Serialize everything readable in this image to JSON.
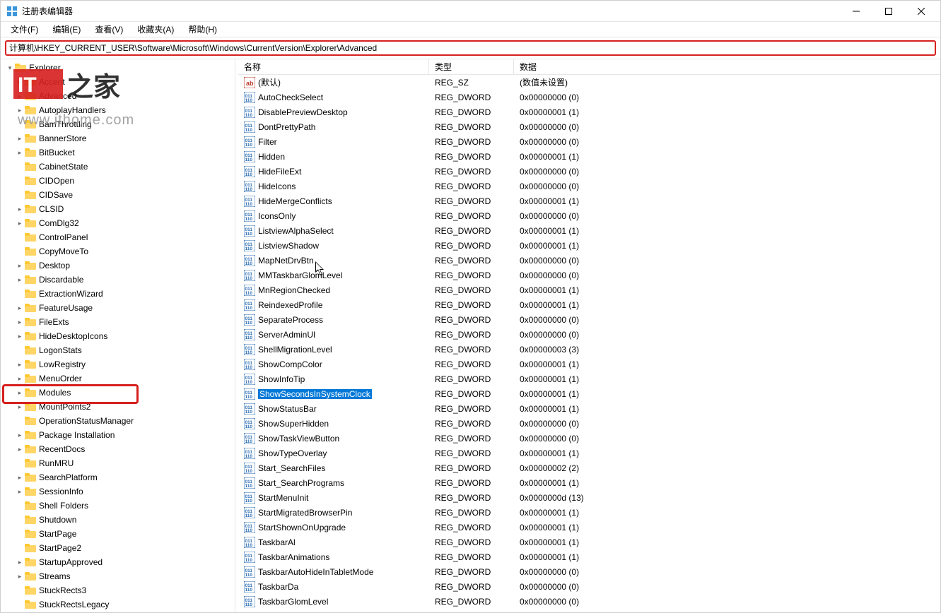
{
  "window": {
    "title": "注册表编辑器"
  },
  "menubar": {
    "file": "文件(F)",
    "edit": "编辑(E)",
    "view": "查看(V)",
    "favorites": "收藏夹(A)",
    "help": "帮助(H)"
  },
  "address": "计算机\\HKEY_CURRENT_USER\\Software\\Microsoft\\Windows\\CurrentVersion\\Explorer\\Advanced",
  "columns": {
    "name": "名称",
    "type": "类型",
    "data": "数据"
  },
  "tree": {
    "items": [
      {
        "label": "Explorer",
        "depth": 0,
        "expanded": true
      },
      {
        "label": "Accent",
        "depth": 1,
        "expandable": true
      },
      {
        "label": "Advanced",
        "depth": 1,
        "expandable": true,
        "truncated": true
      },
      {
        "label": "AutoplayHandlers",
        "depth": 1,
        "expandable": true
      },
      {
        "label": "BamThrottling",
        "depth": 1
      },
      {
        "label": "BannerStore",
        "depth": 1,
        "expandable": true
      },
      {
        "label": "BitBucket",
        "depth": 1,
        "expandable": true
      },
      {
        "label": "CabinetState",
        "depth": 1
      },
      {
        "label": "CIDOpen",
        "depth": 1
      },
      {
        "label": "CIDSave",
        "depth": 1
      },
      {
        "label": "CLSID",
        "depth": 1,
        "expandable": true
      },
      {
        "label": "ComDlg32",
        "depth": 1,
        "expandable": true
      },
      {
        "label": "ControlPanel",
        "depth": 1
      },
      {
        "label": "CopyMoveTo",
        "depth": 1
      },
      {
        "label": "Desktop",
        "depth": 1,
        "expandable": true
      },
      {
        "label": "Discardable",
        "depth": 1,
        "expandable": true
      },
      {
        "label": "ExtractionWizard",
        "depth": 1
      },
      {
        "label": "FeatureUsage",
        "depth": 1,
        "expandable": true
      },
      {
        "label": "FileExts",
        "depth": 1,
        "expandable": true
      },
      {
        "label": "HideDesktopIcons",
        "depth": 1,
        "expandable": true
      },
      {
        "label": "LogonStats",
        "depth": 1
      },
      {
        "label": "LowRegistry",
        "depth": 1,
        "expandable": true
      },
      {
        "label": "MenuOrder",
        "depth": 1,
        "expandable": true
      },
      {
        "label": "Modules",
        "depth": 1,
        "expandable": true
      },
      {
        "label": "MountPoints2",
        "depth": 1,
        "expandable": true
      },
      {
        "label": "OperationStatusManager",
        "depth": 1
      },
      {
        "label": "Package Installation",
        "depth": 1,
        "expandable": true
      },
      {
        "label": "RecentDocs",
        "depth": 1,
        "expandable": true
      },
      {
        "label": "RunMRU",
        "depth": 1
      },
      {
        "label": "SearchPlatform",
        "depth": 1,
        "expandable": true
      },
      {
        "label": "SessionInfo",
        "depth": 1,
        "expandable": true
      },
      {
        "label": "Shell Folders",
        "depth": 1
      },
      {
        "label": "Shutdown",
        "depth": 1
      },
      {
        "label": "StartPage",
        "depth": 1
      },
      {
        "label": "StartPage2",
        "depth": 1
      },
      {
        "label": "StartupApproved",
        "depth": 1,
        "expandable": true
      },
      {
        "label": "Streams",
        "depth": 1,
        "expandable": true
      },
      {
        "label": "StuckRects3",
        "depth": 1
      },
      {
        "label": "StuckRectsLegacy",
        "depth": 1
      }
    ]
  },
  "values": [
    {
      "name": "(默认)",
      "type": "REG_SZ",
      "data": "(数值未设置)",
      "icon": "sz"
    },
    {
      "name": "AutoCheckSelect",
      "type": "REG_DWORD",
      "data": "0x00000000 (0)",
      "icon": "dw"
    },
    {
      "name": "DisablePreviewDesktop",
      "type": "REG_DWORD",
      "data": "0x00000001 (1)",
      "icon": "dw"
    },
    {
      "name": "DontPrettyPath",
      "type": "REG_DWORD",
      "data": "0x00000000 (0)",
      "icon": "dw"
    },
    {
      "name": "Filter",
      "type": "REG_DWORD",
      "data": "0x00000000 (0)",
      "icon": "dw"
    },
    {
      "name": "Hidden",
      "type": "REG_DWORD",
      "data": "0x00000001 (1)",
      "icon": "dw"
    },
    {
      "name": "HideFileExt",
      "type": "REG_DWORD",
      "data": "0x00000000 (0)",
      "icon": "dw"
    },
    {
      "name": "HideIcons",
      "type": "REG_DWORD",
      "data": "0x00000000 (0)",
      "icon": "dw"
    },
    {
      "name": "HideMergeConflicts",
      "type": "REG_DWORD",
      "data": "0x00000001 (1)",
      "icon": "dw"
    },
    {
      "name": "IconsOnly",
      "type": "REG_DWORD",
      "data": "0x00000000 (0)",
      "icon": "dw"
    },
    {
      "name": "ListviewAlphaSelect",
      "type": "REG_DWORD",
      "data": "0x00000001 (1)",
      "icon": "dw"
    },
    {
      "name": "ListviewShadow",
      "type": "REG_DWORD",
      "data": "0x00000001 (1)",
      "icon": "dw"
    },
    {
      "name": "MapNetDrvBtn",
      "type": "REG_DWORD",
      "data": "0x00000000 (0)",
      "icon": "dw"
    },
    {
      "name": "MMTaskbarGlomLevel",
      "type": "REG_DWORD",
      "data": "0x00000000 (0)",
      "icon": "dw"
    },
    {
      "name": "MnRegionChecked",
      "type": "REG_DWORD",
      "data": "0x00000001 (1)",
      "icon": "dw"
    },
    {
      "name": "ReindexedProfile",
      "type": "REG_DWORD",
      "data": "0x00000001 (1)",
      "icon": "dw"
    },
    {
      "name": "SeparateProcess",
      "type": "REG_DWORD",
      "data": "0x00000000 (0)",
      "icon": "dw"
    },
    {
      "name": "ServerAdminUI",
      "type": "REG_DWORD",
      "data": "0x00000000 (0)",
      "icon": "dw"
    },
    {
      "name": "ShellMigrationLevel",
      "type": "REG_DWORD",
      "data": "0x00000003 (3)",
      "icon": "dw"
    },
    {
      "name": "ShowCompColor",
      "type": "REG_DWORD",
      "data": "0x00000001 (1)",
      "icon": "dw"
    },
    {
      "name": "ShowInfoTip",
      "type": "REG_DWORD",
      "data": "0x00000001 (1)",
      "icon": "dw"
    },
    {
      "name": "ShowSecondsInSystemClock",
      "type": "REG_DWORD",
      "data": "0x00000001 (1)",
      "icon": "dw",
      "selected": true
    },
    {
      "name": "ShowStatusBar",
      "type": "REG_DWORD",
      "data": "0x00000001 (1)",
      "icon": "dw"
    },
    {
      "name": "ShowSuperHidden",
      "type": "REG_DWORD",
      "data": "0x00000000 (0)",
      "icon": "dw"
    },
    {
      "name": "ShowTaskViewButton",
      "type": "REG_DWORD",
      "data": "0x00000000 (0)",
      "icon": "dw"
    },
    {
      "name": "ShowTypeOverlay",
      "type": "REG_DWORD",
      "data": "0x00000001 (1)",
      "icon": "dw"
    },
    {
      "name": "Start_SearchFiles",
      "type": "REG_DWORD",
      "data": "0x00000002 (2)",
      "icon": "dw"
    },
    {
      "name": "Start_SearchPrograms",
      "type": "REG_DWORD",
      "data": "0x00000001 (1)",
      "icon": "dw"
    },
    {
      "name": "StartMenuInit",
      "type": "REG_DWORD",
      "data": "0x0000000d (13)",
      "icon": "dw"
    },
    {
      "name": "StartMigratedBrowserPin",
      "type": "REG_DWORD",
      "data": "0x00000001 (1)",
      "icon": "dw"
    },
    {
      "name": "StartShownOnUpgrade",
      "type": "REG_DWORD",
      "data": "0x00000001 (1)",
      "icon": "dw"
    },
    {
      "name": "TaskbarAl",
      "type": "REG_DWORD",
      "data": "0x00000001 (1)",
      "icon": "dw"
    },
    {
      "name": "TaskbarAnimations",
      "type": "REG_DWORD",
      "data": "0x00000001 (1)",
      "icon": "dw"
    },
    {
      "name": "TaskbarAutoHideInTabletMode",
      "type": "REG_DWORD",
      "data": "0x00000000 (0)",
      "icon": "dw"
    },
    {
      "name": "TaskbarDa",
      "type": "REG_DWORD",
      "data": "0x00000000 (0)",
      "icon": "dw"
    },
    {
      "name": "TaskbarGlomLevel",
      "type": "REG_DWORD",
      "data": "0x00000000 (0)",
      "icon": "dw"
    }
  ]
}
